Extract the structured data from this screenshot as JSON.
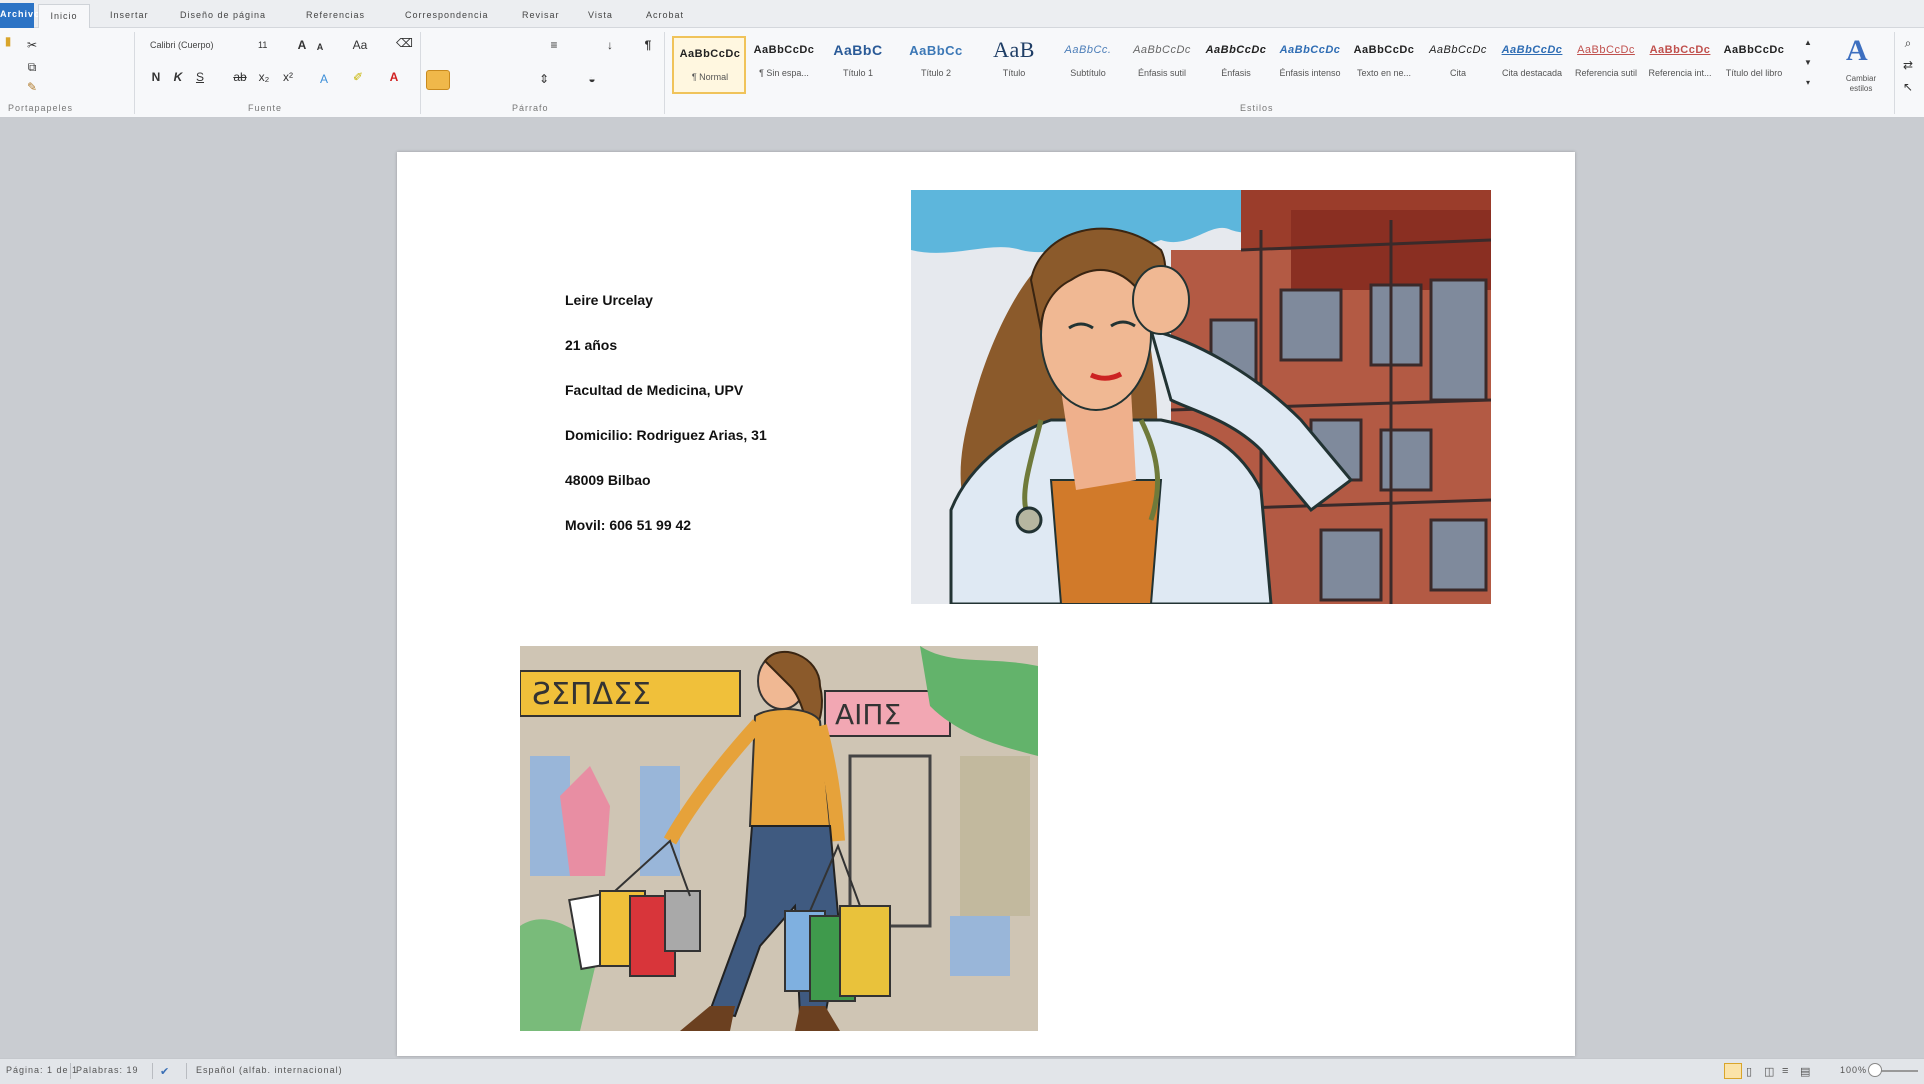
{
  "app": {
    "tabs": [
      "Archivo",
      "Inicio",
      "Insertar",
      "Diseño de página",
      "Referencias",
      "Correspondencia",
      "Revisar",
      "Vista",
      "Acrobat"
    ]
  },
  "ribbon": {
    "groups": [
      "Portapapeles",
      "Fuente",
      "Párrafo",
      "Estilos"
    ],
    "font": {
      "name": "Calibri (Cuerpo)",
      "size": "11"
    },
    "styles": [
      {
        "sample": "AaBbCcDc",
        "name": "¶ Normal"
      },
      {
        "sample": "AaBbCcDc",
        "name": "¶ Sin espa..."
      },
      {
        "sample": "AaBbC",
        "name": "Título 1"
      },
      {
        "sample": "AaBbCc",
        "name": "Título 2"
      },
      {
        "sample": "AaB",
        "name": "Título"
      },
      {
        "sample": "AaBbCc.",
        "name": "Subtítulo"
      },
      {
        "sample": "AaBbCcDc",
        "name": "Énfasis sutil"
      },
      {
        "sample": "AaBbCcDc",
        "name": "Énfasis"
      },
      {
        "sample": "AaBbCcDc",
        "name": "Énfasis intenso"
      },
      {
        "sample": "AaBbCcDc",
        "name": "Texto en ne..."
      },
      {
        "sample": "AaBbCcDc",
        "name": "Cita"
      },
      {
        "sample": "AaBbCcDc",
        "name": "Cita destacada"
      },
      {
        "sample": "AaBbCcDc",
        "name": "Referencia sutil"
      },
      {
        "sample": "AaBbCcDc",
        "name": "Referencia int..."
      },
      {
        "sample": "AaBbCcDc",
        "name": "Título del libro"
      }
    ],
    "change_styles": "Cambiar estilos"
  },
  "document": {
    "lines": [
      "Leire Urcelay",
      "21 años",
      "Facultad de Medicina, UPV",
      "Domicilio: Rodriguez Arias, 31",
      "48009 Bilbao",
      "Movil: 606 51 99 42"
    ],
    "images": [
      "doctor-illustration",
      "shopping-illustration"
    ]
  },
  "status": {
    "page": "Página: 1 de 1",
    "words": "Palabras: 19",
    "language": "Español (alfab. internacional)",
    "zoom": "100%"
  },
  "colors": {
    "accent": "#2b73c5",
    "page": "#ffffff",
    "workspace": "#c9ccd1"
  }
}
